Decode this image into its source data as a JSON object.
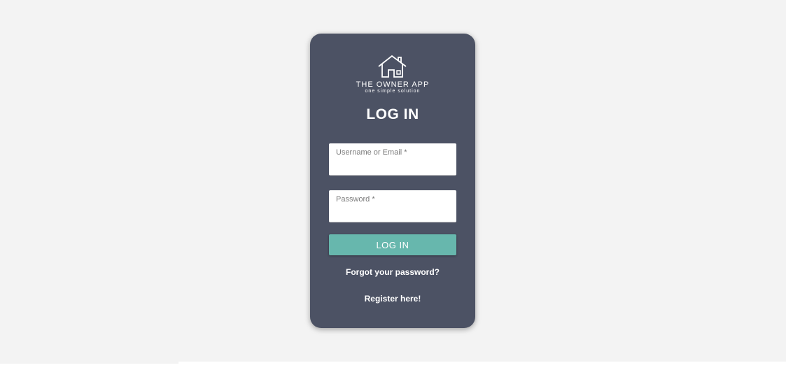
{
  "brand": {
    "logo_icon": "house-icon",
    "name": "THE OWNER APP",
    "tagline": "one simple solution"
  },
  "login_form": {
    "title": "LOG IN",
    "username": {
      "label": "Username or Email *",
      "value": ""
    },
    "password": {
      "label": "Password *",
      "value": ""
    },
    "submit_label": "LOG IN",
    "forgot_password_label": "Forgot your password?",
    "register_label": "Register here!"
  },
  "colors": {
    "card_background": "#4c5264",
    "page_background": "#f3f3f3",
    "accent_button": "#67b7ad",
    "text_light": "#ffffff"
  }
}
